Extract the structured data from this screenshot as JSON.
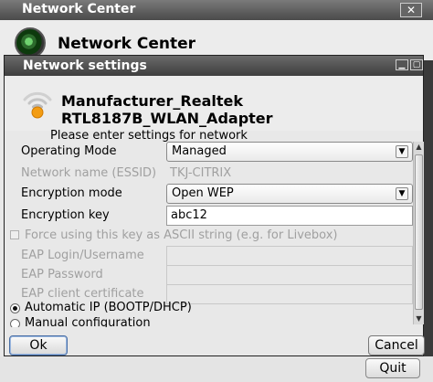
{
  "background_window": {
    "title": "Network Center",
    "close_label": "✕",
    "header_title": "Network Center",
    "quit_label": "Quit"
  },
  "dialog": {
    "title": "Network settings",
    "minimize_label": "▁",
    "maximize_label": "▢",
    "adapter_name": "Manufacturer_Realtek RTL8187B_WLAN_Adapter",
    "instruction": "Please enter settings for network",
    "fields": {
      "operating_mode_label": "Operating Mode",
      "operating_mode_value": "Managed",
      "essid_label": "Network name (ESSID)",
      "essid_value": "TKJ-CITRIX",
      "encryption_mode_label": "Encryption mode",
      "encryption_mode_value": "Open WEP",
      "encryption_key_label": "Encryption key",
      "encryption_key_value": "abc12",
      "force_ascii_label": "Force using this key as ASCII string (e.g. for Livebox)",
      "eap_login_label": "EAP Login/Username",
      "eap_password_label": "EAP Password",
      "eap_cert_label": "EAP client certificate",
      "auto_ip_label": "Automatic IP (BOOTP/DHCP)",
      "manual_config_label": "Manual configuration"
    },
    "buttons": {
      "ok_label": "Ok",
      "cancel_label": "Cancel"
    }
  },
  "colors": {
    "titlebar": "#4a4a4a",
    "dialog_bg": "#e8e8e8",
    "wifi_orange": "#f39c12",
    "disabled_text": "#a0a0a0"
  }
}
